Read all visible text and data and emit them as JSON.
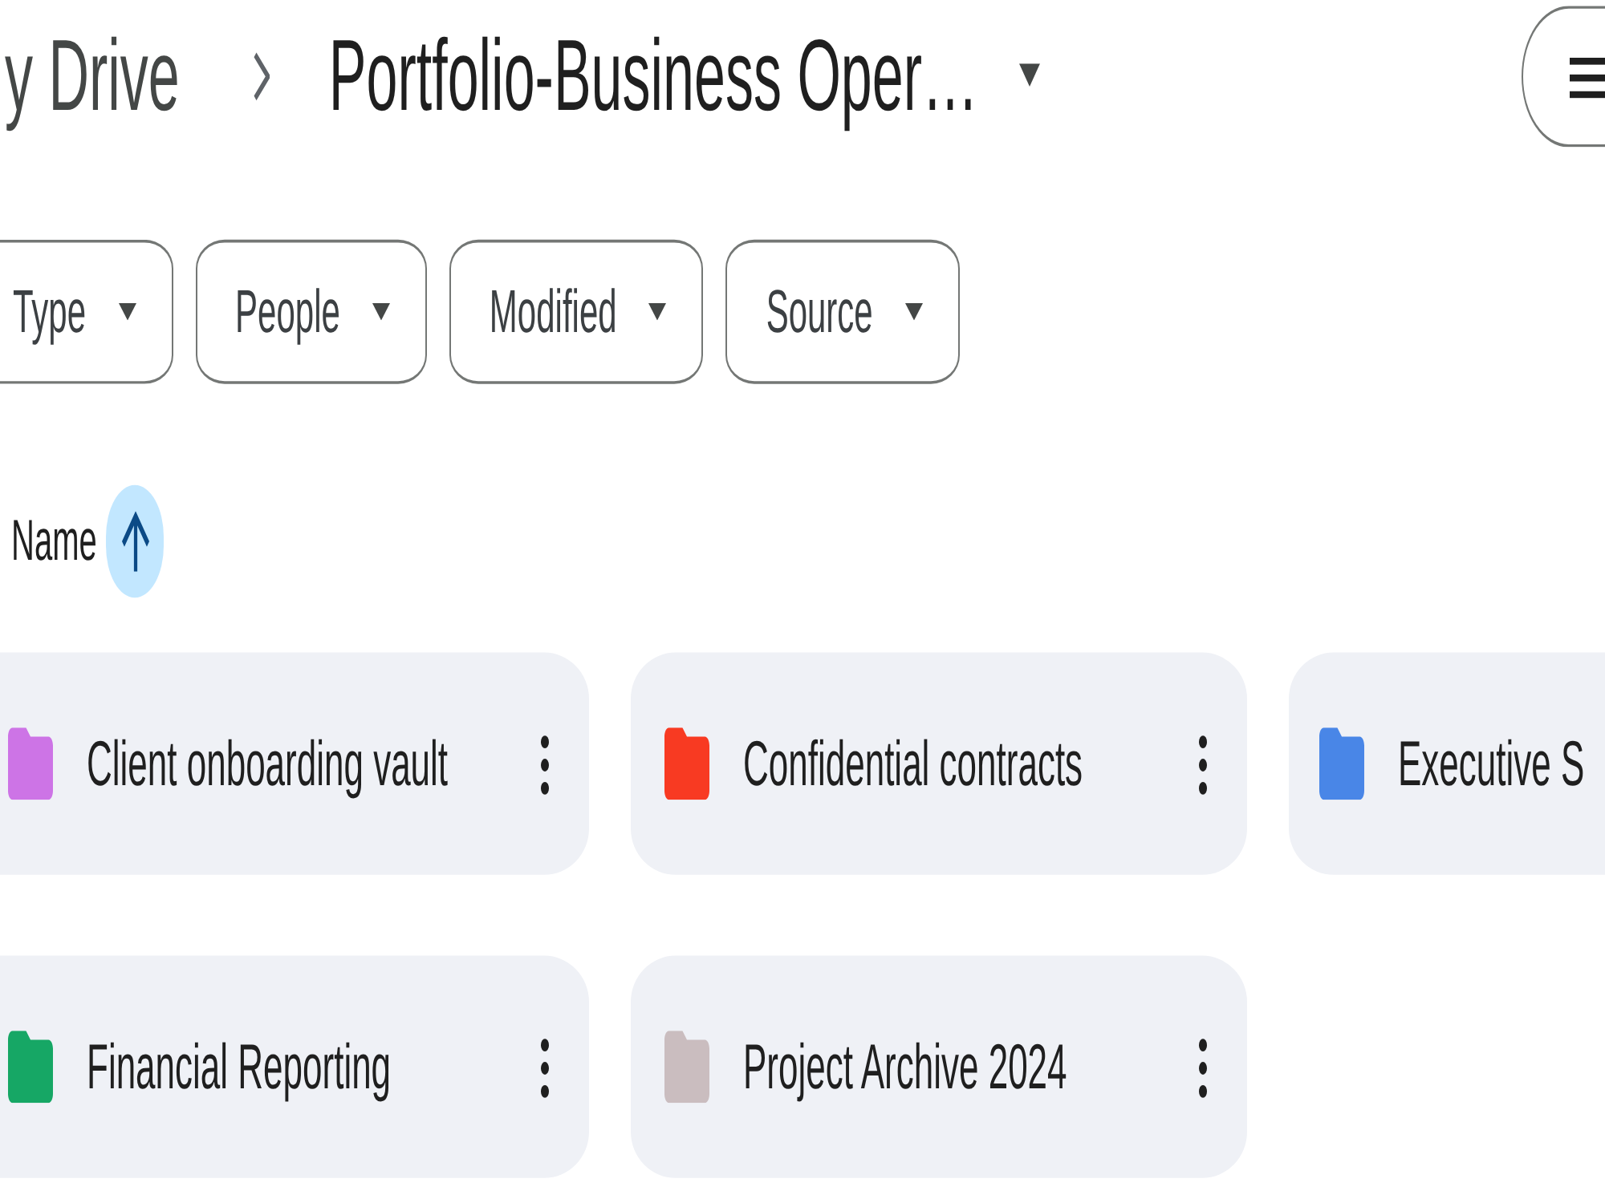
{
  "breadcrumb": {
    "parent": "y Drive",
    "current": "Portfolio-Business Oper…"
  },
  "filters": [
    {
      "label": "Type"
    },
    {
      "label": "People"
    },
    {
      "label": "Modified"
    },
    {
      "label": "Source"
    }
  ],
  "sort": {
    "label": "Name",
    "ascending": true
  },
  "folders": [
    {
      "name": "Client onboarding vault",
      "color": "#cd74e6"
    },
    {
      "name": "Confidential contracts",
      "color": "#f83a22"
    },
    {
      "name": "Executive S",
      "color": "#4986e7"
    },
    {
      "name": "Financial Reporting",
      "color": "#16a765"
    },
    {
      "name": "Project Archive 2024",
      "color": "#cabdbf"
    }
  ]
}
